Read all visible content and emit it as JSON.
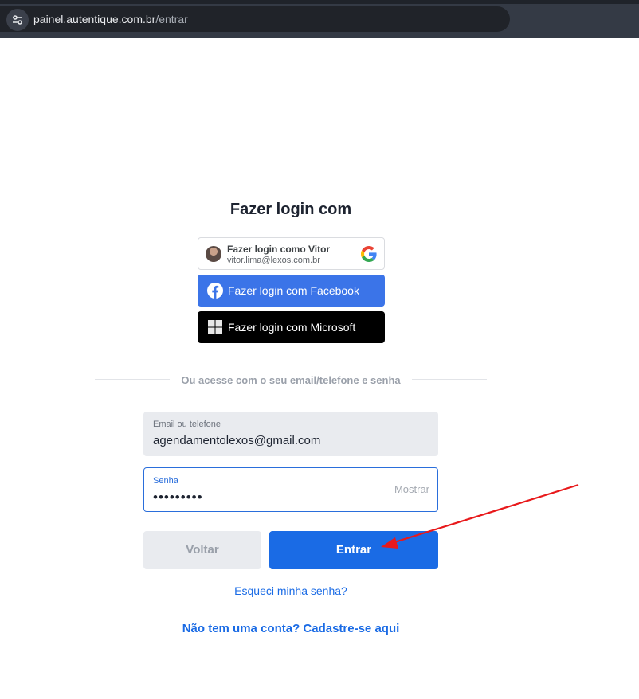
{
  "browser": {
    "url_host": "painel.autentique.com.br",
    "url_path": "/entrar"
  },
  "login": {
    "title": "Fazer login com",
    "google": {
      "line1": "Fazer login como Vitor",
      "line2": "vitor.lima@lexos.com.br"
    },
    "facebook_label": "Fazer login com Facebook",
    "microsoft_label": "Fazer login com Microsoft",
    "divider_text": "Ou acesse com o seu email/telefone e senha",
    "email_field": {
      "label": "Email ou telefone",
      "value": "agendamentolexos@gmail.com"
    },
    "password_field": {
      "label": "Senha",
      "value": "•••••••••",
      "show_label": "Mostrar"
    },
    "back_button": "Voltar",
    "enter_button": "Entrar",
    "forgot_link": "Esqueci minha senha?",
    "signup_link": "Não tem uma conta? Cadastre-se aqui"
  },
  "colors": {
    "primary": "#1a6be5",
    "facebook": "#3b74e8",
    "microsoft": "#000000",
    "annotation_arrow": "#e8191b"
  },
  "icons": [
    "tune-icon",
    "avatar",
    "google-icon",
    "facebook-icon",
    "microsoft-icon",
    "annotation-arrow"
  ]
}
